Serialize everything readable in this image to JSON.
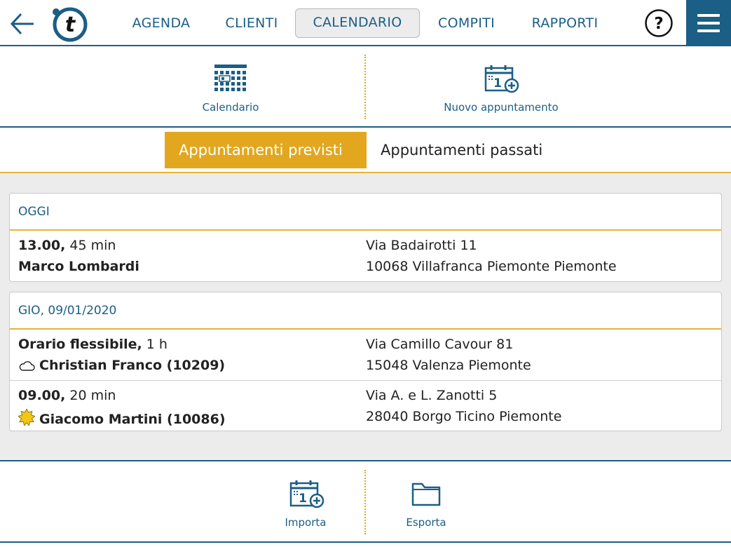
{
  "nav": {
    "items": [
      "AGENDA",
      "CLIENTI",
      "CALENDARIO",
      "COMPITI",
      "RAPPORTI"
    ],
    "active": "CALENDARIO",
    "help_label": "?"
  },
  "toolbar": {
    "calendar_label": "Calendario",
    "new_appointment_label": "Nuovo appuntamento"
  },
  "tabs": {
    "upcoming": "Appuntamenti previsti",
    "past": "Appuntamenti passati"
  },
  "groups": [
    {
      "header": "OGGI",
      "appointments": [
        {
          "time": "13.00,",
          "duration": " 45 min",
          "client": "Marco Lombardi",
          "weather_icon": "",
          "street": "Via Badairotti 11",
          "city": "10068 Villafranca Piemonte Piemonte"
        }
      ]
    },
    {
      "header": "GIO, 09/01/2020",
      "appointments": [
        {
          "time": "Orario flessibile,",
          "duration": " 1 h",
          "client": "Christian Franco (10209)",
          "weather_icon": "cloud-icon",
          "street": "Via Camillo Cavour 81",
          "city": "15048 Valenza Piemonte"
        },
        {
          "time": "09.00,",
          "duration": " 20 min",
          "client": "Giacomo Martini (10086)",
          "weather_icon": "sun-icon",
          "street": "Via A. e L. Zanotti 5",
          "city": "28040 Borgo Ticino Piemonte"
        }
      ]
    }
  ],
  "bottom": {
    "import_label": "Importa",
    "export_label": "Esporta"
  },
  "colors": {
    "primary": "#1b5e86",
    "accent": "#e2a71f",
    "content_bg": "#ececec"
  }
}
